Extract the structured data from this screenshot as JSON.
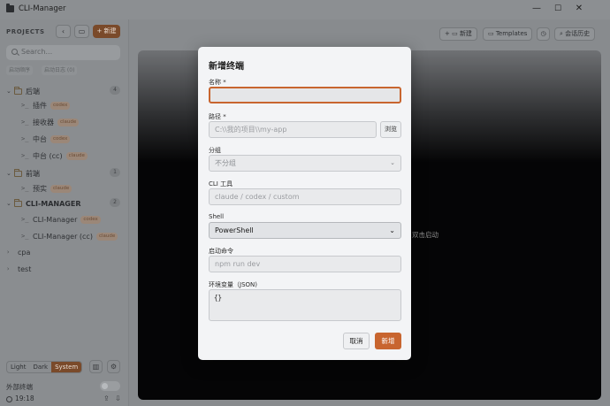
{
  "window": {
    "title": "CLI-Manager",
    "minimize": "—",
    "maximize": "☐",
    "close": "✕"
  },
  "sidebar": {
    "projects_label": "PROJECTS",
    "new_label": "+ 新建",
    "search_placeholder": "Search...",
    "sort_options": [
      "启动顺序",
      "启动日志 (0)"
    ],
    "groups": [
      {
        "name": "后端",
        "count": "4",
        "items": [
          {
            "name": "插件",
            "tag": "codex"
          },
          {
            "name": "接收器",
            "tag": "claude"
          },
          {
            "name": "中台",
            "tag": "codex"
          },
          {
            "name": "中台 (cc)",
            "tag": "claude"
          }
        ]
      },
      {
        "name": "前端",
        "count": "1",
        "items": [
          {
            "name": "预实",
            "tag": "claude"
          }
        ]
      },
      {
        "name": "CLI-MANAGER",
        "count": "2",
        "items": [
          {
            "name": "CLI-Manager",
            "tag": "codex"
          },
          {
            "name": "CLI-Manager (cc)",
            "tag": "claude"
          }
        ]
      }
    ],
    "loose_items": [
      "cpa",
      "test"
    ],
    "theme": {
      "options": [
        "Light",
        "Dark",
        "System"
      ],
      "selected": "System"
    },
    "external_terminal_label": "外部终端",
    "time": "19:18"
  },
  "toolbar": {
    "new_label": "新建",
    "templates_label": "Templates",
    "history_label": "会话历史"
  },
  "terminal": {
    "hint": "双击启动"
  },
  "modal": {
    "title": "新增终端",
    "name_label": "名称 *",
    "name_value": "",
    "path_label": "路径 *",
    "path_placeholder": "C:\\\\我的项目\\\\my-app",
    "browse_label": "浏览",
    "group_label": "分组",
    "group_value": "不分组",
    "cli_label": "CLI 工具",
    "cli_placeholder": "claude / codex / custom",
    "shell_label": "Shell",
    "shell_value": "PowerShell",
    "startup_label": "启动命令",
    "startup_placeholder": "npm run dev",
    "env_label": "环境变量（JSON)",
    "env_value": "{}",
    "cancel_label": "取消",
    "submit_label": "新增"
  },
  "colors": {
    "accent": "#c8652f",
    "accent_dim": "#7a4a2a",
    "modal_bg": "#f3f4f6"
  }
}
